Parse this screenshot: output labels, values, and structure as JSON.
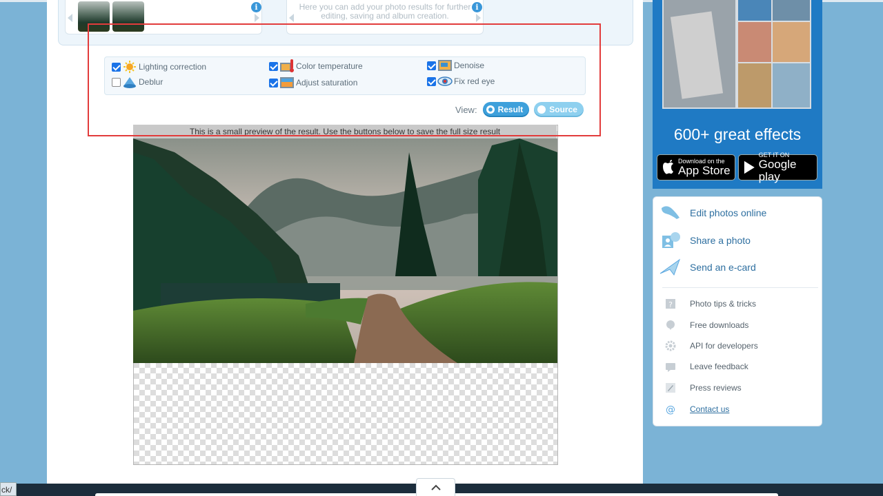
{
  "thumbs_panel": {
    "hint_text": "Here you can add your photo results for further editing, saving and album creation."
  },
  "options": [
    {
      "label": "Lighting correction",
      "checked": true,
      "icon": "sun-icon"
    },
    {
      "label": "Deblur",
      "checked": false,
      "icon": "deblur-icon"
    },
    {
      "label": "Color temperature",
      "checked": true,
      "icon": "thermometer-icon"
    },
    {
      "label": "Adjust saturation",
      "checked": true,
      "icon": "saturation-icon"
    },
    {
      "label": "Denoise",
      "checked": true,
      "icon": "denoise-icon"
    },
    {
      "label": "Fix red eye",
      "checked": true,
      "icon": "eye-icon"
    }
  ],
  "view": {
    "label": "View:",
    "result_label": "Result",
    "source_label": "Source",
    "selected": "Result"
  },
  "preview": {
    "note": "This is a small preview of the result. Use the buttons below to save the full size result"
  },
  "ad": {
    "headline": "600+ great effects",
    "appstore_small": "Download on the",
    "appstore_big": "App Store",
    "googleplay_small": "GET IT ON",
    "googleplay_big": "Google play"
  },
  "sidebar": {
    "primary_links": [
      {
        "label": "Edit photos online",
        "icon": "brush-icon"
      },
      {
        "label": "Share a photo",
        "icon": "share-photo-icon"
      },
      {
        "label": "Send an e-card",
        "icon": "ecard-icon"
      }
    ],
    "secondary_links": [
      {
        "label": "Photo tips & tricks",
        "icon": "question-icon"
      },
      {
        "label": "Free downloads",
        "icon": "download-icon"
      },
      {
        "label": "API for developers",
        "icon": "gear-icon"
      },
      {
        "label": "Leave feedback",
        "icon": "comment-icon"
      },
      {
        "label": "Press reviews",
        "icon": "pencil-icon"
      },
      {
        "label": "Contact us",
        "icon": "at-icon"
      }
    ]
  },
  "status_tip": "ck/",
  "colors": {
    "accent": "#3ea0db",
    "link": "#2e6fa0",
    "ad_bg": "#1f7ac4",
    "highlight_box": "#e23b3b",
    "page_bg": "#7bb3d6"
  }
}
